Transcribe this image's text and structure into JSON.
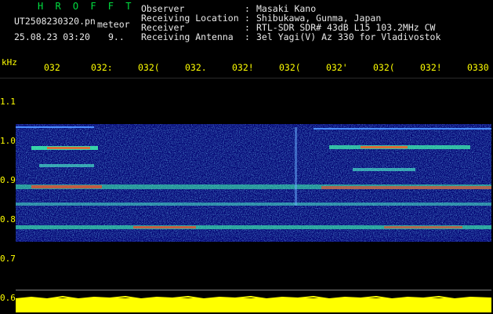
{
  "app_title": "H R O F F T",
  "file": {
    "name": "UT2508230320.pn",
    "tag": "meteor",
    "datetime": "25.08.23 03:20",
    "count": "9.."
  },
  "meta": {
    "colon": ":",
    "rows": [
      {
        "label": "Observer",
        "value": "Masaki Kano"
      },
      {
        "label": "Receiving Location",
        "value": "Shibukawa, Gunma, Japan"
      },
      {
        "label": "Receiver",
        "value": "RTL-SDR SDR# 43dB L15 103.2MHz CW"
      },
      {
        "label": "Receiving Antenna",
        "value": "3el Yagi(V) Az 330 for Vladivostok"
      }
    ]
  },
  "axis": {
    "unit": "kHz",
    "time_ticks": [
      "032",
      "032:",
      "032(",
      "032.",
      "032!",
      "032(",
      "032'",
      "032(",
      "032!",
      "0330"
    ],
    "freq_ticks": [
      "1.1",
      "1.0",
      "0.9",
      "0.8",
      "0.7",
      "0.6"
    ]
  },
  "colors": {
    "label_text": "#e8e8e8",
    "title_green": "#00e040",
    "axis_yellow": "#ffff00",
    "background": "#000000",
    "spectrum_bg": "#000080"
  }
}
